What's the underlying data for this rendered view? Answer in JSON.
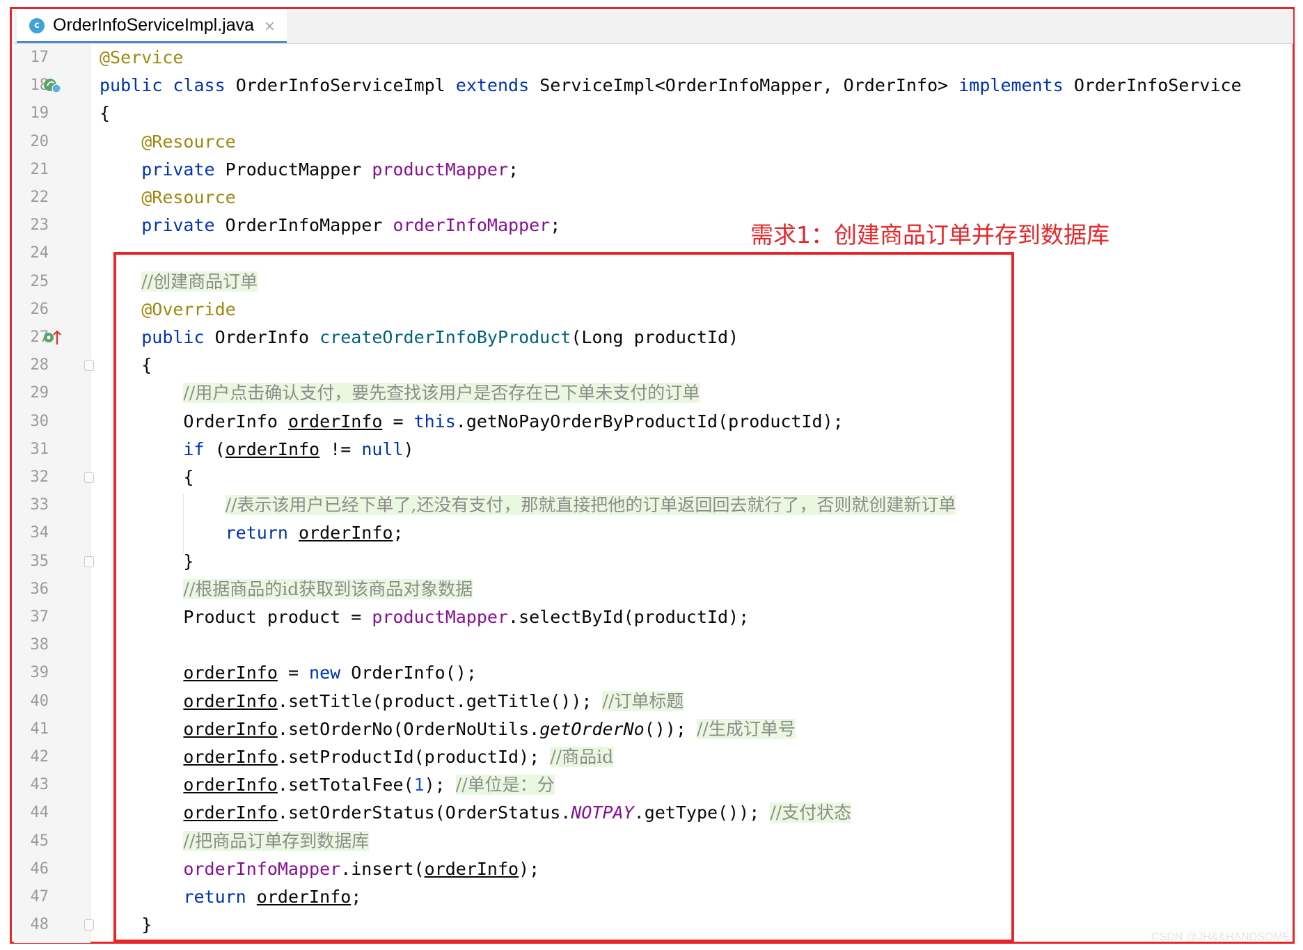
{
  "tab": {
    "title": "OrderInfoServiceImpl.java",
    "close": "×",
    "icon": "c"
  },
  "annotation": "需求1：创建商品订单并存到数据库",
  "watermark": "CSDN @JH&&HANDSOME",
  "code_lines": [
    {
      "no": 17,
      "text": "@Service"
    },
    {
      "no": 18,
      "text": "public class OrderInfoServiceImpl extends ServiceImpl<OrderInfoMapper, OrderInfo> implements OrderInfoService"
    },
    {
      "no": 19,
      "text": "{"
    },
    {
      "no": 20,
      "text": "    @Resource"
    },
    {
      "no": 21,
      "text": "    private ProductMapper productMapper;"
    },
    {
      "no": 22,
      "text": "    @Resource"
    },
    {
      "no": 23,
      "text": "    private OrderInfoMapper orderInfoMapper;"
    },
    {
      "no": 24,
      "text": ""
    },
    {
      "no": 25,
      "text": "    //创建商品订单"
    },
    {
      "no": 26,
      "text": "    @Override"
    },
    {
      "no": 27,
      "text": "    public OrderInfo createOrderInfoByProduct(Long productId)"
    },
    {
      "no": 28,
      "text": "    {"
    },
    {
      "no": 29,
      "text": "        //用户点击确认支付，要先查找该用户是否存在已下单未支付的订单"
    },
    {
      "no": 30,
      "text": "        OrderInfo orderInfo = this.getNoPayOrderByProductId(productId);"
    },
    {
      "no": 31,
      "text": "        if (orderInfo != null)"
    },
    {
      "no": 32,
      "text": "        {"
    },
    {
      "no": 33,
      "text": "            //表示该用户已经下单了,还没有支付，那就直接把他的订单返回回去就行了，否则就创建新订单"
    },
    {
      "no": 34,
      "text": "            return orderInfo;"
    },
    {
      "no": 35,
      "text": "        }"
    },
    {
      "no": 36,
      "text": "        //根据商品的id获取到该商品对象数据"
    },
    {
      "no": 37,
      "text": "        Product product = productMapper.selectById(productId);"
    },
    {
      "no": 38,
      "text": ""
    },
    {
      "no": 39,
      "text": "        orderInfo = new OrderInfo();"
    },
    {
      "no": 40,
      "text": "        orderInfo.setTitle(product.getTitle()); //订单标题"
    },
    {
      "no": 41,
      "text": "        orderInfo.setOrderNo(OrderNoUtils.getOrderNo()); //生成订单号"
    },
    {
      "no": 42,
      "text": "        orderInfo.setProductId(productId); //商品id"
    },
    {
      "no": 43,
      "text": "        orderInfo.setTotalFee(1); //单位是：分"
    },
    {
      "no": 44,
      "text": "        orderInfo.setOrderStatus(OrderStatus.NOTPAY.getType()); //支付状态"
    },
    {
      "no": 45,
      "text": "        //把商品订单存到数据库"
    },
    {
      "no": 46,
      "text": "        orderInfoMapper.insert(orderInfo);"
    },
    {
      "no": 47,
      "text": "        return orderInfo;"
    },
    {
      "no": 48,
      "text": "    }"
    }
  ],
  "colors": {
    "keyword": "#0033b3",
    "annotation": "#9e880d",
    "field": "#871094",
    "method": "#00627a",
    "comment": "#8c8c8c",
    "comment_bg": "#eaf8e0",
    "highlight_box": "#e8262a"
  },
  "gutter_icons": {
    "18": "implements-spring-bean-icon",
    "27": "override-up-arrow-icon"
  }
}
